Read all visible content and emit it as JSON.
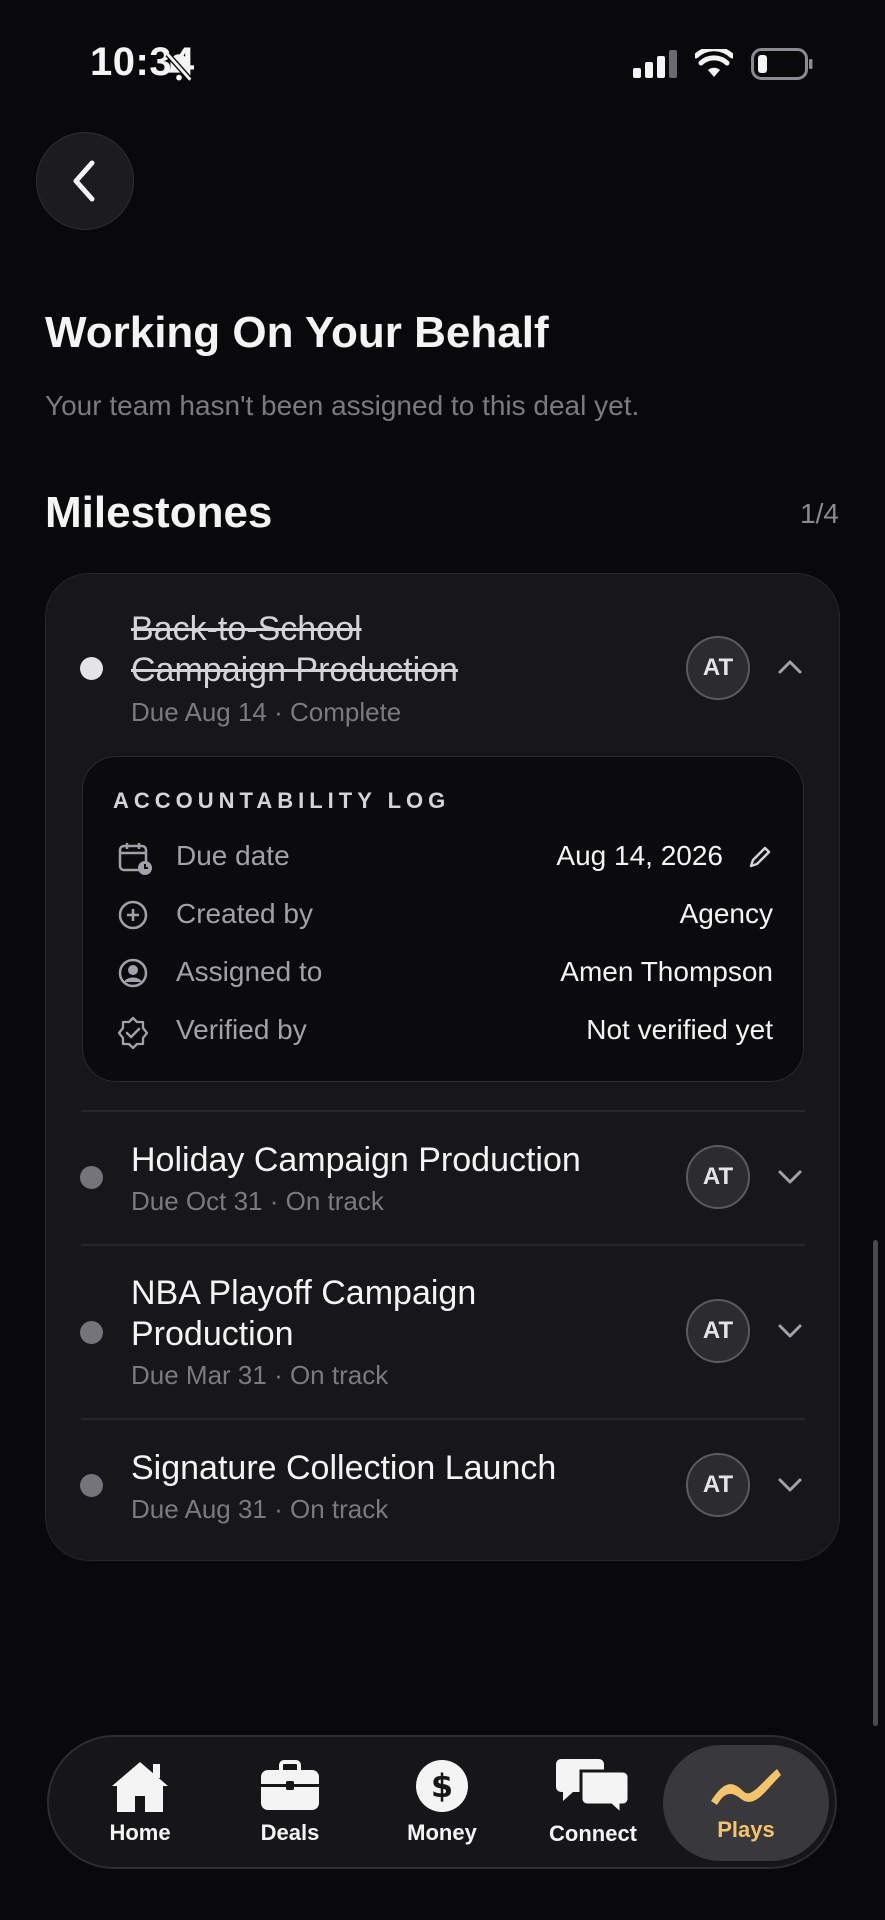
{
  "status_bar": {
    "time": "10:34"
  },
  "header": {
    "title": "Working On Your Behalf",
    "subtitle": "Your team hasn't been assigned to this deal yet."
  },
  "milestones": {
    "title": "Milestones",
    "count": "1/4",
    "items": [
      {
        "title_line1": "Back-to-School",
        "title_line2": "Campaign Production",
        "meta": "Due Aug 14 · Complete",
        "avatar": "AT",
        "expanded": true
      },
      {
        "title_line1": "Holiday Campaign Production",
        "meta": "Due Oct 31 · On track",
        "avatar": "AT",
        "expanded": false
      },
      {
        "title_line1": "NBA Playoff Campaign",
        "title_line2": "Production",
        "meta": "Due Mar 31 · On track",
        "avatar": "AT",
        "expanded": false
      },
      {
        "title_line1": "Signature Collection Launch",
        "meta": "Due Aug 31 · On track",
        "avatar": "AT",
        "expanded": false
      }
    ]
  },
  "accountability_log": {
    "heading": "ACCOUNTABILITY LOG",
    "rows": [
      {
        "label": "Due date",
        "value": "Aug 14, 2026",
        "icon": "calendar-clock-icon"
      },
      {
        "label": "Created by",
        "value": "Agency",
        "icon": "plus-circle-icon"
      },
      {
        "label": "Assigned to",
        "value": "Amen Thompson",
        "icon": "user-circle-icon"
      },
      {
        "label": "Verified by",
        "value": "Not verified yet",
        "icon": "badge-check-icon"
      }
    ]
  },
  "tabbar": {
    "tabs": [
      {
        "label": "Home",
        "icon": "home-icon"
      },
      {
        "label": "Deals",
        "icon": "briefcase-icon"
      },
      {
        "label": "Money",
        "icon": "dollar-icon"
      },
      {
        "label": "Connect",
        "icon": "chat-bubbles-icon"
      },
      {
        "label": "Plays",
        "icon": "plays-icon"
      }
    ],
    "active": "Plays"
  },
  "colors": {
    "accent": "#f5c469",
    "background": "#09090b",
    "card": "#17171a"
  }
}
